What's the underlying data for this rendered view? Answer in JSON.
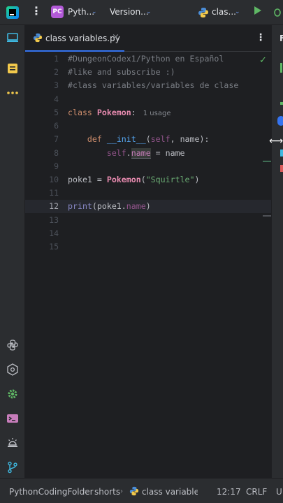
{
  "toolbar": {
    "project_badge": "PC",
    "project_name": "Pyth...",
    "vcs_label": "Version...",
    "run_config": "clas...",
    "chevron": "⌄",
    "kebab": "⋮"
  },
  "tabs": [
    {
      "label": "class variables.py",
      "close": "×"
    }
  ],
  "editor": {
    "line_numbers": [
      "1",
      "2",
      "3",
      "4",
      "5",
      "6",
      "7",
      "8",
      "9",
      "10",
      "11",
      "12",
      "13",
      "14",
      "15"
    ],
    "current_line": "12",
    "lines": {
      "l1": "#DungeonCodex1/Python en Español",
      "l2": "#like and subscribe :)",
      "l3": "#class variables/variables de clase",
      "l5_kw": "class",
      "l5_name": "Pokemon",
      "l5_colon": ":",
      "l5_usage": "1 usage",
      "l7_def": "def",
      "l7_fn": "__init__",
      "l7_open": "(",
      "l7_self": "self",
      "l7_rest": ", name):",
      "l8_self": "self",
      "l8_dot": ".",
      "l8_attr": "name",
      "l8_rest": " = name",
      "l10_var": "poke1 = ",
      "l10_cls": "Pokemon",
      "l10_open": "(",
      "l10_str": "\"Squirtle\"",
      "l10_close": ")",
      "l12_print": "print",
      "l12_rest": "(poke1.",
      "l12_attr": "name",
      "l12_close": ")"
    },
    "inspection_icon": "check-icon"
  },
  "right_panel": {
    "letter": "F"
  },
  "statusbar": {
    "breadcrumb": [
      "PythonCodingFolder",
      "shorts",
      "class variables.p"
    ],
    "separator": "›",
    "position": "12:17",
    "line_ending": "CRLF",
    "encoding": "U"
  },
  "colors": {
    "accent": "#3574f0",
    "background": "#1e1f22",
    "panel": "#2b2d30",
    "keyword": "#cf8e6d",
    "string": "#6aab73",
    "comment": "#7a7e85",
    "function": "#57aaf7"
  }
}
